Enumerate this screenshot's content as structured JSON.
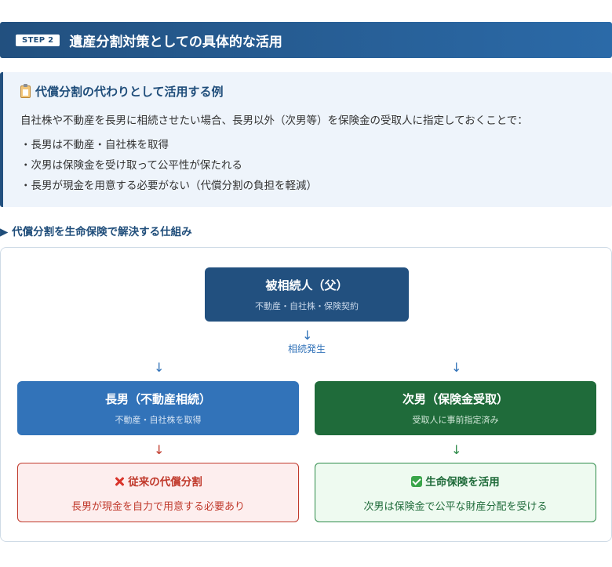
{
  "header": {
    "step_badge": "STEP 2",
    "title": "遺産分割対策としての具体的な活用"
  },
  "info": {
    "heading": "代償分割の代わりとして活用する例",
    "lead": "自社株や不動産を長男に相続させたい場合、長男以外（次男等）を保険金の受取人に指定しておくことで：",
    "items": [
      "・長男は不動産・自社株を取得",
      "・次男は保険金を受け取って公平性が保たれる",
      "・長男が現金を用意する必要がない（代償分割の負担を軽減）"
    ]
  },
  "section_label": "▶ 代償分割を生命保険で解決する仕組み",
  "diagram": {
    "parent": {
      "title": "被相続人（父）",
      "sub": "不動産・自社株・保険契約"
    },
    "occurrence_arrow": "↓",
    "occurrence_label": "相続発生",
    "arrow_down": "↓",
    "elder": {
      "title": "長男（不動産相続）",
      "sub": "不動産・自社株を取得"
    },
    "second": {
      "title": "次男（保険金受取）",
      "sub": "受取人に事前指定済み"
    },
    "old_way": {
      "title": "従来の代償分割",
      "sub": "長男が現金を自力で用意する必要あり"
    },
    "new_way": {
      "title": "生命保険を活用",
      "sub": "次男は保険金で公平な財産分配を受ける"
    }
  },
  "colors": {
    "primary": "#22507f",
    "elder": "#3273b9",
    "second": "#1f6b3a",
    "warning": "#c0392b",
    "success": "#2e8b4a"
  },
  "icons": [
    "clipboard-icon",
    "cross-icon",
    "check-icon"
  ]
}
